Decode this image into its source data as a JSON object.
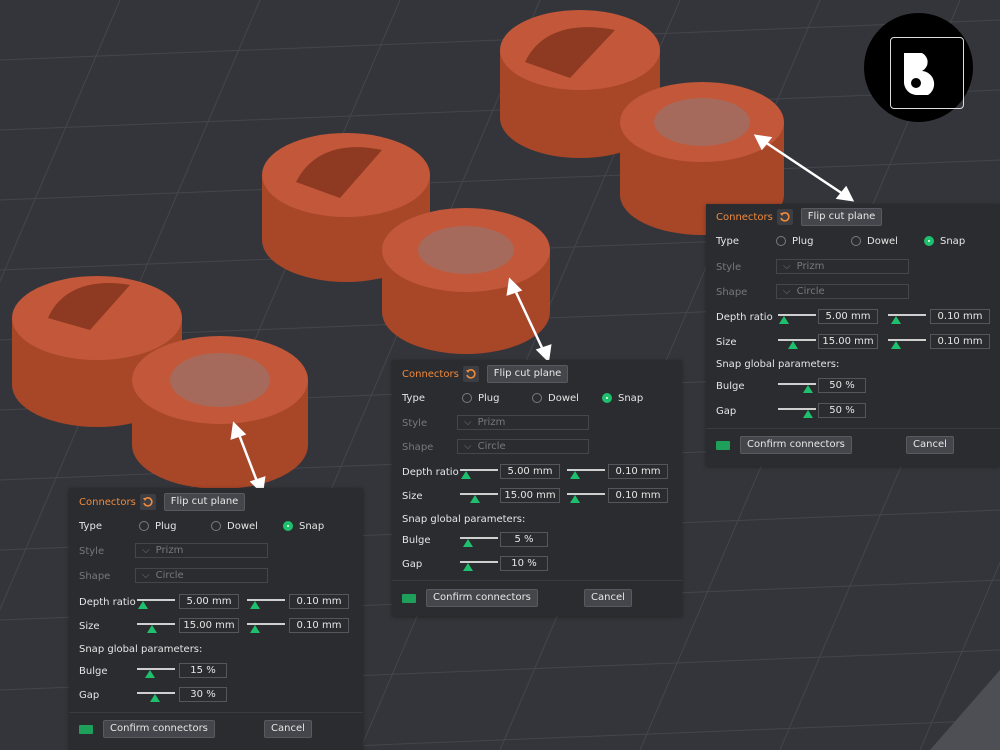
{
  "panels": [
    {
      "connectors_label": "Connectors",
      "flip_label": "Flip cut plane",
      "type_label": "Type",
      "type_options": [
        "Plug",
        "Dowel",
        "Snap"
      ],
      "selected_type": "Snap",
      "style_label": "Style",
      "style_value": "Prizm",
      "shape_label": "Shape",
      "shape_value": "Circle",
      "depth_ratio_label": "Depth ratio",
      "depth_ratio_value": "5.00  mm",
      "depth_ratio_tolerance": "0.10  mm",
      "size_label": "Size",
      "size_value": "15.00  mm",
      "size_tolerance": "0.10  mm",
      "snap_params_label": "Snap global parameters:",
      "bulge_label": "Bulge",
      "bulge_value": "15 %",
      "gap_label": "Gap",
      "gap_value": "30 %",
      "confirm_label": "Confirm connectors",
      "cancel_label": "Cancel"
    },
    {
      "connectors_label": "Connectors",
      "flip_label": "Flip cut plane",
      "type_label": "Type",
      "type_options": [
        "Plug",
        "Dowel",
        "Snap"
      ],
      "selected_type": "Snap",
      "style_label": "Style",
      "style_value": "Prizm",
      "shape_label": "Shape",
      "shape_value": "Circle",
      "depth_ratio_label": "Depth ratio",
      "depth_ratio_value": "5.00  mm",
      "depth_ratio_tolerance": "0.10  mm",
      "size_label": "Size",
      "size_value": "15.00  mm",
      "size_tolerance": "0.10  mm",
      "snap_params_label": "Snap global parameters:",
      "bulge_label": "Bulge",
      "bulge_value": "5 %",
      "gap_label": "Gap",
      "gap_value": "10 %",
      "confirm_label": "Confirm connectors",
      "cancel_label": "Cancel"
    },
    {
      "connectors_label": "Connectors",
      "flip_label": "Flip cut plane",
      "type_label": "Type",
      "type_options": [
        "Plug",
        "Dowel",
        "Snap"
      ],
      "selected_type": "Snap",
      "style_label": "Style",
      "style_value": "Prizm",
      "shape_label": "Shape",
      "shape_value": "Circle",
      "depth_ratio_label": "Depth ratio",
      "depth_ratio_value": "5.00  mm",
      "depth_ratio_tolerance": "0.10  mm",
      "size_label": "Size",
      "size_value": "15.00  mm",
      "size_tolerance": "0.10  mm",
      "snap_params_label": "Snap global parameters:",
      "bulge_label": "Bulge",
      "bulge_value": "50 %",
      "gap_label": "Gap",
      "gap_value": "50 %",
      "confirm_label": "Confirm connectors",
      "cancel_label": "Cancel"
    }
  ],
  "slider_levels": [
    {
      "depth_ratio": 0.05,
      "depth_tol": 0.1,
      "size": 0.35,
      "size_tol": 0.1,
      "bulge": 0.3,
      "gap": 0.45
    },
    {
      "depth_ratio": 0.05,
      "depth_tol": 0.1,
      "size": 0.35,
      "size_tol": 0.1,
      "bulge": 0.1,
      "gap": 0.1
    },
    {
      "depth_ratio": 0.05,
      "depth_tol": 0.1,
      "size": 0.35,
      "size_tol": 0.1,
      "bulge": 0.9,
      "gap": 0.9
    }
  ],
  "colors": {
    "accent": "#f08a3a",
    "selected": "#1ec06d",
    "part": "#b9512f",
    "background": "#34353a"
  },
  "logo_icon": "b-logo-icon"
}
